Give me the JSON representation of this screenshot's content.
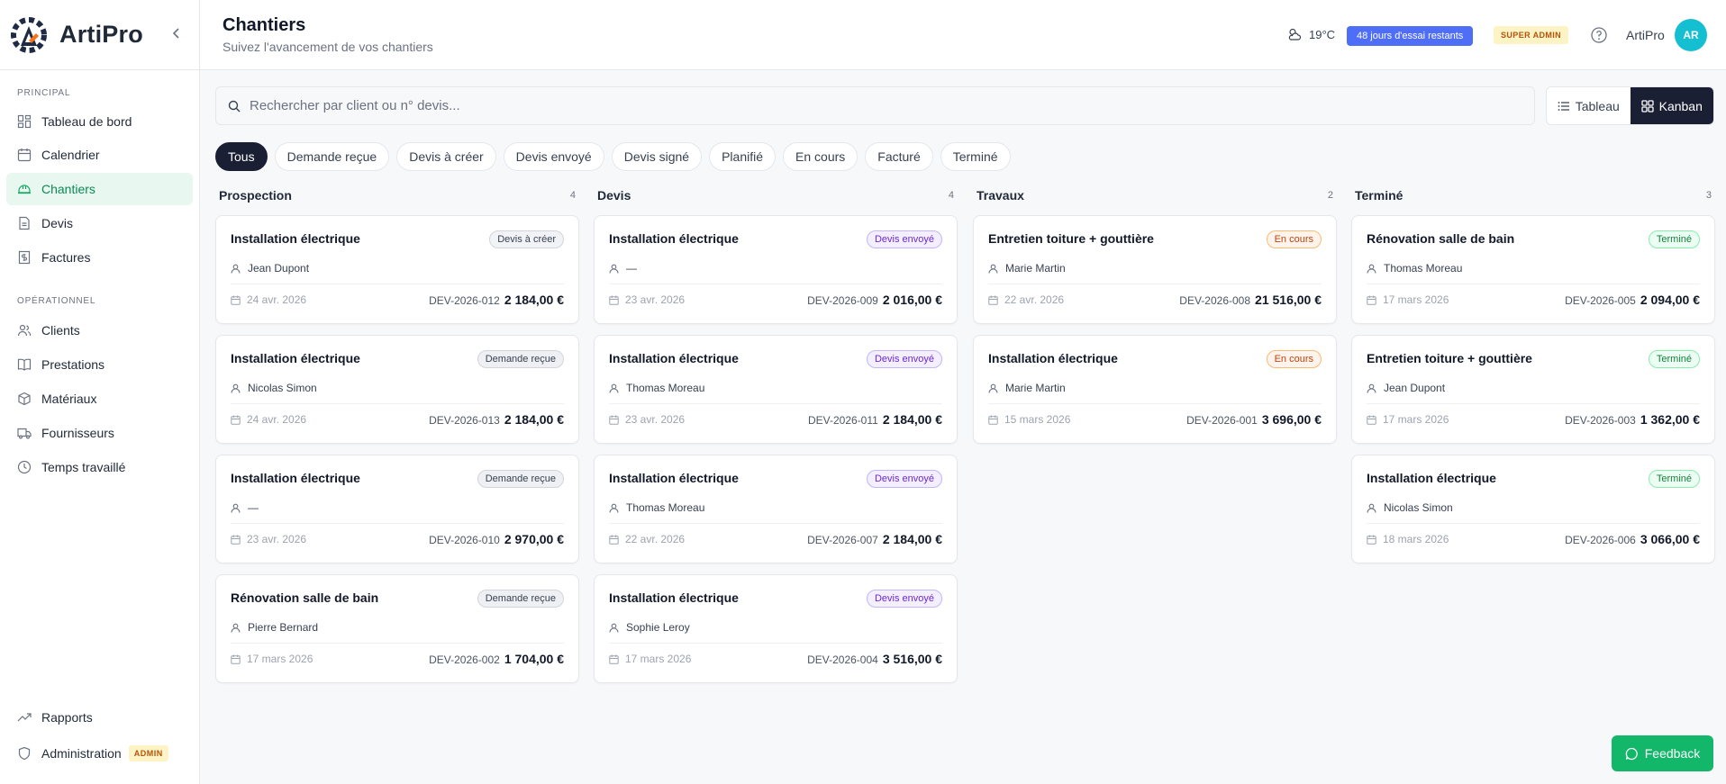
{
  "app": {
    "name": "ArtiPro"
  },
  "sidebar": {
    "sections": [
      {
        "label": "PRINCIPAL"
      },
      {
        "label": "OPÉRATIONNEL"
      }
    ],
    "items": [
      {
        "label": "Tableau de bord",
        "icon": "dashboard-icon"
      },
      {
        "label": "Calendrier",
        "icon": "calendar-icon"
      },
      {
        "label": "Chantiers",
        "icon": "hardhat-icon",
        "active": true
      },
      {
        "label": "Devis",
        "icon": "document-icon"
      },
      {
        "label": "Factures",
        "icon": "invoice-icon"
      },
      {
        "label": "Clients",
        "icon": "users-icon"
      },
      {
        "label": "Prestations",
        "icon": "book-icon"
      },
      {
        "label": "Matériaux",
        "icon": "package-icon"
      },
      {
        "label": "Fournisseurs",
        "icon": "truck-icon"
      },
      {
        "label": "Temps travaillé",
        "icon": "clock-icon"
      }
    ],
    "bottom": [
      {
        "label": "Rapports",
        "icon": "trending-icon"
      },
      {
        "label": "Administration",
        "icon": "shield-icon",
        "badge": "ADMIN"
      }
    ]
  },
  "header": {
    "title": "Chantiers",
    "subtitle": "Suivez l'avancement de vos chantiers",
    "weather": "19°C",
    "trial": "48 jours d'essai restants",
    "role": "SUPER ADMIN",
    "user": "ArtiPro",
    "avatar": "AR"
  },
  "search": {
    "placeholder": "Rechercher par client ou n° devis...",
    "value": ""
  },
  "view": {
    "table": "Tableau",
    "kanban": "Kanban",
    "active": "Kanban"
  },
  "filters": [
    "Tous",
    "Demande reçue",
    "Devis à créer",
    "Devis envoyé",
    "Devis signé",
    "Planifié",
    "En cours",
    "Facturé",
    "Terminé"
  ],
  "active_filter": "Tous",
  "columns": [
    {
      "title": "Prospection",
      "count": "4",
      "cards": [
        {
          "title": "Installation électrique",
          "status": "Devis à créer",
          "status_class": "creer",
          "client": "Jean Dupont",
          "date": "24 avr. 2026",
          "ref": "DEV-2026-012",
          "amount": "2 184,00 €"
        },
        {
          "title": "Installation électrique",
          "status": "Demande reçue",
          "status_class": "recue",
          "client": "Nicolas Simon",
          "date": "24 avr. 2026",
          "ref": "DEV-2026-013",
          "amount": "2 184,00 €"
        },
        {
          "title": "Installation électrique",
          "status": "Demande reçue",
          "status_class": "recue",
          "client": "—",
          "date": "23 avr. 2026",
          "ref": "DEV-2026-010",
          "amount": "2 970,00 €"
        },
        {
          "title": "Rénovation salle de bain",
          "status": "Demande reçue",
          "status_class": "recue",
          "client": "Pierre Bernard",
          "date": "17 mars 2026",
          "ref": "DEV-2026-002",
          "amount": "1 704,00 €"
        }
      ]
    },
    {
      "title": "Devis",
      "count": "4",
      "cards": [
        {
          "title": "Installation électrique",
          "status": "Devis envoyé",
          "status_class": "envoye",
          "client": "—",
          "date": "23 avr. 2026",
          "ref": "DEV-2026-009",
          "amount": "2 016,00 €"
        },
        {
          "title": "Installation électrique",
          "status": "Devis envoyé",
          "status_class": "envoye",
          "client": "Thomas Moreau",
          "date": "23 avr. 2026",
          "ref": "DEV-2026-011",
          "amount": "2 184,00 €"
        },
        {
          "title": "Installation électrique",
          "status": "Devis envoyé",
          "status_class": "envoye",
          "client": "Thomas Moreau",
          "date": "22 avr. 2026",
          "ref": "DEV-2026-007",
          "amount": "2 184,00 €"
        },
        {
          "title": "Installation électrique",
          "status": "Devis envoyé",
          "status_class": "envoye",
          "client": "Sophie Leroy",
          "date": "17 mars 2026",
          "ref": "DEV-2026-004",
          "amount": "3 516,00 €"
        }
      ]
    },
    {
      "title": "Travaux",
      "count": "2",
      "cards": [
        {
          "title": "Entretien toiture + gouttière",
          "status": "En cours",
          "status_class": "encours",
          "client": "Marie Martin",
          "date": "22 avr. 2026",
          "ref": "DEV-2026-008",
          "amount": "21 516,00 €"
        },
        {
          "title": "Installation électrique",
          "status": "En cours",
          "status_class": "encours",
          "client": "Marie Martin",
          "date": "15 mars 2026",
          "ref": "DEV-2026-001",
          "amount": "3 696,00 €"
        }
      ]
    },
    {
      "title": "Terminé",
      "count": "3",
      "cards": [
        {
          "title": "Rénovation salle de bain",
          "status": "Terminé",
          "status_class": "termine",
          "client": "Thomas Moreau",
          "date": "17 mars 2026",
          "ref": "DEV-2026-005",
          "amount": "2 094,00 €"
        },
        {
          "title": "Entretien toiture + gouttière",
          "status": "Terminé",
          "status_class": "termine",
          "client": "Jean Dupont",
          "date": "17 mars 2026",
          "ref": "DEV-2026-003",
          "amount": "1 362,00 €"
        },
        {
          "title": "Installation électrique",
          "status": "Terminé",
          "status_class": "termine",
          "client": "Nicolas Simon",
          "date": "18 mars 2026",
          "ref": "DEV-2026-006",
          "amount": "3 066,00 €"
        }
      ]
    }
  ],
  "feedback": "Feedback",
  "colors": {
    "accent": "#12b76a",
    "dark": "#1b1f33",
    "trial": "#4f6ef7",
    "avatar": "#13bfd1"
  }
}
